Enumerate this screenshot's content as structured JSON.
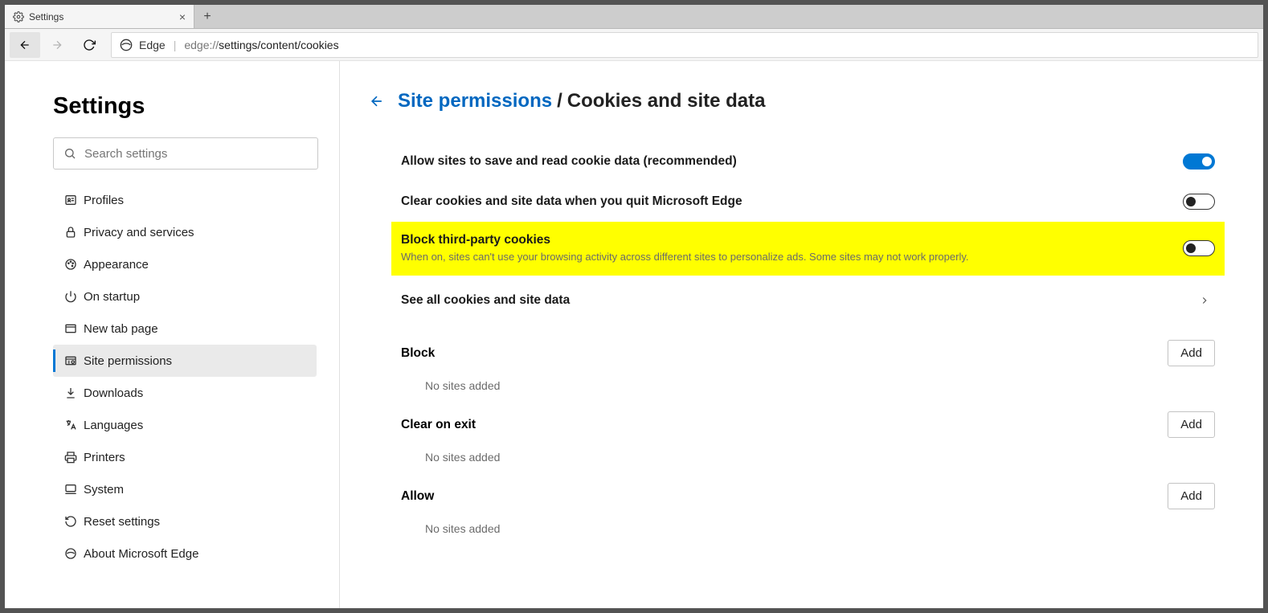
{
  "tab": {
    "title": "Settings"
  },
  "address": {
    "site": "Edge",
    "prefix": "edge://",
    "path": "settings/content/cookies"
  },
  "sidebar": {
    "title": "Settings",
    "search_placeholder": "Search settings",
    "items": [
      {
        "label": "Profiles"
      },
      {
        "label": "Privacy and services"
      },
      {
        "label": "Appearance"
      },
      {
        "label": "On startup"
      },
      {
        "label": "New tab page"
      },
      {
        "label": "Site permissions"
      },
      {
        "label": "Downloads"
      },
      {
        "label": "Languages"
      },
      {
        "label": "Printers"
      },
      {
        "label": "System"
      },
      {
        "label": "Reset settings"
      },
      {
        "label": "About Microsoft Edge"
      }
    ]
  },
  "main": {
    "breadcrumb_link": "Site permissions",
    "breadcrumb_here": "Cookies and site data",
    "allow_cookies": "Allow sites to save and read cookie data (recommended)",
    "clear_on_quit": "Clear cookies and site data when you quit Microsoft Edge",
    "block_third": "Block third-party cookies",
    "block_third_sub": "When on, sites can't use your browsing activity across different sites to personalize ads. Some sites may not work properly.",
    "see_all": "See all cookies and site data",
    "block_section": "Block",
    "clear_section": "Clear on exit",
    "allow_section": "Allow",
    "no_sites": "No sites added",
    "add": "Add"
  }
}
